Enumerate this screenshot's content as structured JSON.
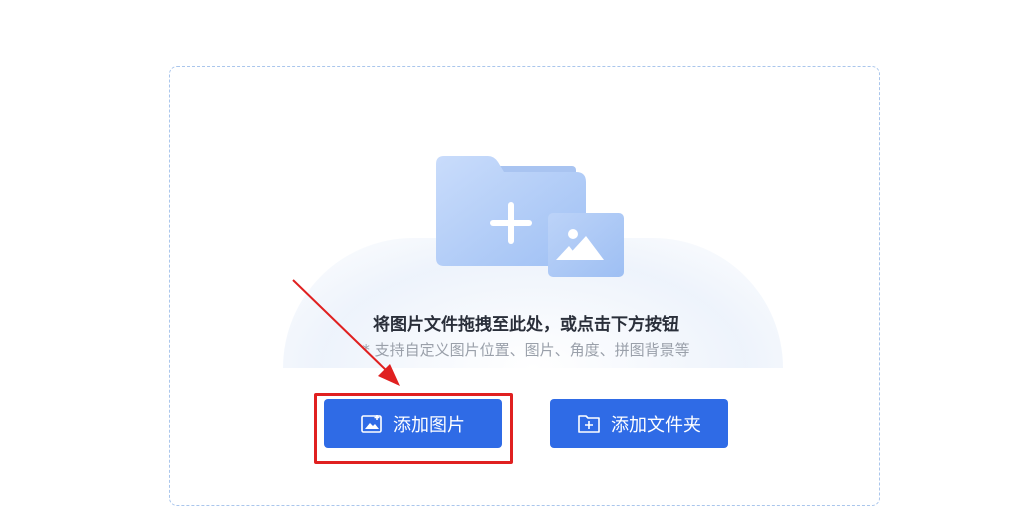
{
  "upload": {
    "headline": "将图片文件拖拽至此处，或点击下方按钮",
    "subline": "* 支持自定义图片位置、图片、角度、拼图背景等"
  },
  "buttons": {
    "add_image_label": "添加图片",
    "add_image_icon": "image-icon",
    "add_folder_label": "添加文件夹",
    "add_folder_icon": "folder-plus-icon"
  },
  "annotation": {
    "highlight_color": "#e02020",
    "arrow_icon": "red-arrow-icon"
  },
  "theme": {
    "accent": "#2f6be6",
    "dropzone_border": "#aac6ec",
    "illustration_blue": "#a9c6f5"
  }
}
